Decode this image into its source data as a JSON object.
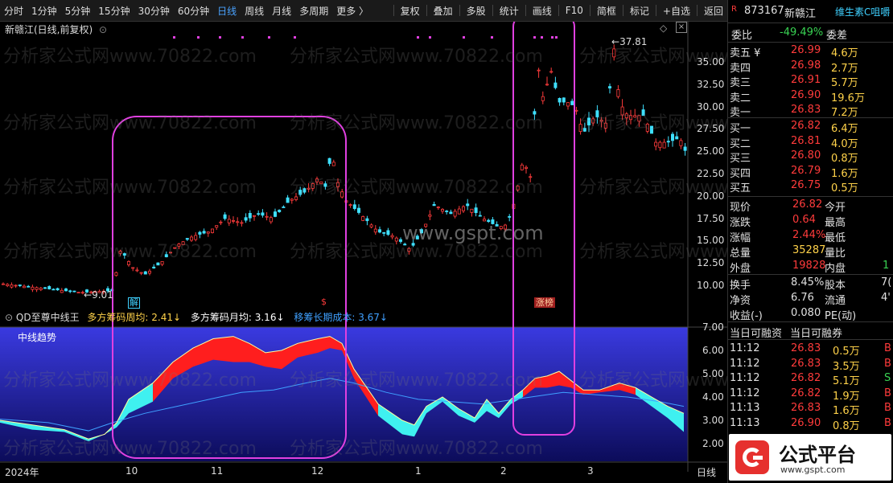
{
  "toolbar": {
    "items": [
      "分时",
      "1分钟",
      "5分钟",
      "15分钟",
      "30分钟",
      "60分钟",
      "日线",
      "周线",
      "月线",
      "多周期",
      "更多 〉"
    ],
    "active_index": 6,
    "right_items": [
      "复权",
      "叠加",
      "多股",
      "统计",
      "画线",
      "F10",
      "简框",
      "标记",
      "+自选",
      "返回"
    ]
  },
  "chart": {
    "title": "新赣江(日线,前复权)",
    "watermark": "分析家公式网www.70822.com",
    "gspt": "www.gspt.com",
    "price_labels": [
      "35.00",
      "32.50",
      "30.00",
      "27.50",
      "25.00",
      "22.50",
      "20.00",
      "17.50",
      "15.00",
      "12.50",
      "10.00"
    ],
    "high_label": "37.81",
    "low_label": "9.01",
    "markers": [
      {
        "text": "解",
        "color": "#3fd0ff"
      },
      {
        "text": "$",
        "color": "#ff3b3b"
      },
      {
        "text": "涨榜",
        "color": "#ffd0a0"
      }
    ]
  },
  "indicator": {
    "name": "QD至尊中线王",
    "items": [
      {
        "label": "多方筹码周均: 2.41",
        "color": "#ffd24a",
        "arrow": "↓"
      },
      {
        "label": "多方筹码月均: 3.16",
        "color": "#ffffff",
        "arrow": "↓"
      },
      {
        "label": "移筹长期成本: 3.67",
        "color": "#3fa0ff",
        "arrow": "↓"
      }
    ],
    "sub_label": "中线趋势",
    "axis_labels": [
      "7.00",
      "6.00",
      "5.00",
      "4.00",
      "3.00",
      "2.00"
    ]
  },
  "xaxis": {
    "labels": [
      "2024年",
      "10",
      "11",
      "12",
      "1",
      "2",
      "3"
    ],
    "right": "日线"
  },
  "panel": {
    "code": "873167",
    "name": "新赣江",
    "extra": "维生素C咀嚼",
    "weibi_label": "委比",
    "weibi_value": "-49.49%",
    "weicha_label": "委差",
    "sells": [
      {
        "label": "卖五 ¥",
        "price": "26.99",
        "vol": "4.6万"
      },
      {
        "label": "卖四",
        "price": "26.98",
        "vol": "2.7万"
      },
      {
        "label": "卖三",
        "price": "26.91",
        "vol": "5.7万"
      },
      {
        "label": "卖二",
        "price": "26.90",
        "vol": "19.6万"
      },
      {
        "label": "卖一",
        "price": "26.83",
        "vol": "7.2万"
      }
    ],
    "buys": [
      {
        "label": "买一",
        "price": "26.82",
        "vol": "6.4万"
      },
      {
        "label": "买二",
        "price": "26.81",
        "vol": "4.0万"
      },
      {
        "label": "买三",
        "price": "26.80",
        "vol": "0.8万"
      },
      {
        "label": "买四",
        "price": "26.79",
        "vol": "1.6万"
      },
      {
        "label": "买五",
        "price": "26.75",
        "vol": "0.5万"
      }
    ],
    "quote": [
      {
        "l1": "现价",
        "v1": "26.82",
        "c1": "red",
        "l2": "今开",
        "v2": ""
      },
      {
        "l1": "涨跌",
        "v1": "0.64",
        "c1": "red",
        "l2": "最高",
        "v2": ""
      },
      {
        "l1": "涨幅",
        "v1": "2.44%",
        "c1": "red",
        "l2": "最低",
        "v2": ""
      },
      {
        "l1": "总量",
        "v1": "35287",
        "c1": "yellow",
        "l2": "量比",
        "v2": ""
      },
      {
        "l1": "外盘",
        "v1": "19828",
        "c1": "red",
        "l2": "内盘",
        "v2": "1"
      }
    ],
    "stats": [
      {
        "l1": "换手",
        "v1": "8.45%",
        "l2": "股本",
        "v2": "7("
      },
      {
        "l1": "净资",
        "v1": "6.76",
        "l2": "流通",
        "v2": "4'"
      },
      {
        "l1": "收益(-)",
        "v1": "0.080",
        "l2": "PE(动)",
        "v2": ""
      }
    ],
    "margin_left": "当日可融资",
    "margin_right": "当日可融券",
    "ticks": [
      {
        "time": "11:12",
        "price": "26.83",
        "vol": "0.5万",
        "flag": "B"
      },
      {
        "time": "11:12",
        "price": "26.83",
        "vol": "3.5万",
        "flag": "B"
      },
      {
        "time": "11:12",
        "price": "26.82",
        "vol": "5.1万",
        "flag": "S"
      },
      {
        "time": "11:12",
        "price": "26.82",
        "vol": "1.9万",
        "flag": "B"
      },
      {
        "time": "11:13",
        "price": "26.83",
        "vol": "1.6万",
        "flag": "B"
      },
      {
        "time": "11:13",
        "price": "26.90",
        "vol": "0.8万",
        "flag": "B"
      }
    ],
    "logo_text": "公式平台",
    "logo_url": "www.gspt.com"
  }
}
